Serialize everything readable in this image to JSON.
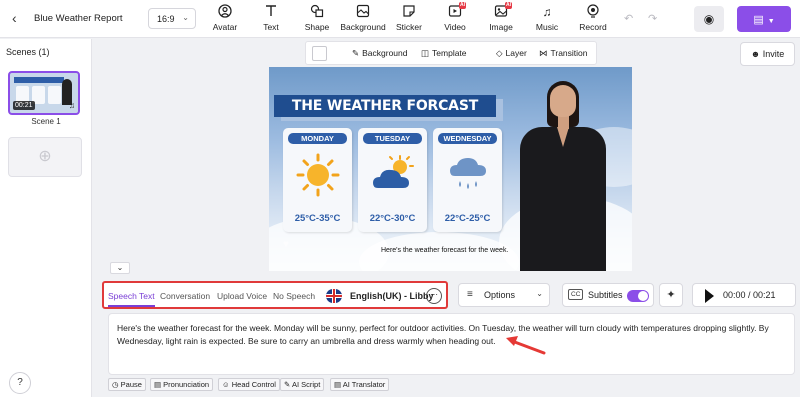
{
  "header": {
    "back_icon": "chevron-left-icon",
    "project_title": "Blue Weather Report",
    "aspect_ratio": "16:9",
    "tools": [
      {
        "label": "Avatar",
        "icon": "avatar-icon",
        "ai": false
      },
      {
        "label": "Text",
        "icon": "text-icon",
        "ai": false
      },
      {
        "label": "Shape",
        "icon": "shape-icon",
        "ai": false
      },
      {
        "label": "Background",
        "icon": "background-icon",
        "ai": false
      },
      {
        "label": "Sticker",
        "icon": "sticker-icon",
        "ai": false
      },
      {
        "label": "Video",
        "icon": "video-icon",
        "ai": true
      },
      {
        "label": "Image",
        "icon": "image-icon",
        "ai": true
      },
      {
        "label": "Music",
        "icon": "music-icon",
        "ai": false
      },
      {
        "label": "Record",
        "icon": "record-icon",
        "ai": false
      }
    ],
    "ai_badge": "AI",
    "accent_color": "#8b4ee8"
  },
  "sidebar": {
    "scenes_title": "Scenes (1)",
    "scenes": [
      {
        "label": "Scene 1",
        "duration": "00:21"
      }
    ]
  },
  "canvas_toolbar": {
    "background": "Background",
    "template": "Template",
    "layer": "Layer",
    "transition": "Transition"
  },
  "invite_label": "Invite",
  "scene": {
    "banner": "THE WEATHER FORCAST",
    "cards": [
      {
        "day": "MONDAY",
        "temp": "25°C-35°C",
        "icon": "sun-icon"
      },
      {
        "day": "TUESDAY",
        "temp": "22°C-30°C",
        "icon": "partly-cloudy-icon"
      },
      {
        "day": "WEDNESDAY",
        "temp": "22°C-25°C",
        "icon": "rain-cloud-icon"
      }
    ],
    "caption": "Here's the weather forecast for the week."
  },
  "speech": {
    "tabs": [
      "Speech Text",
      "Conversation",
      "Upload Voice",
      "No Speech"
    ],
    "active_tab": "Speech Text",
    "voice": "English(UK) - Libby",
    "options_label": "Options",
    "subtitles_label": "Subtitles",
    "subtitles_on": true,
    "time": "00:00 / 00:21",
    "text": "Here's the weather forecast for the week. Monday will be sunny, perfect for outdoor activities. On Tuesday, the weather will turn cloudy with temperatures dropping slightly. By Wednesday, light rain is expected. Be sure to carry an umbrella and dress warmly when heading out."
  },
  "bottom_tools": [
    "Pause",
    "Pronunciation",
    "Head Control",
    "AI Script",
    "AI Translator"
  ]
}
